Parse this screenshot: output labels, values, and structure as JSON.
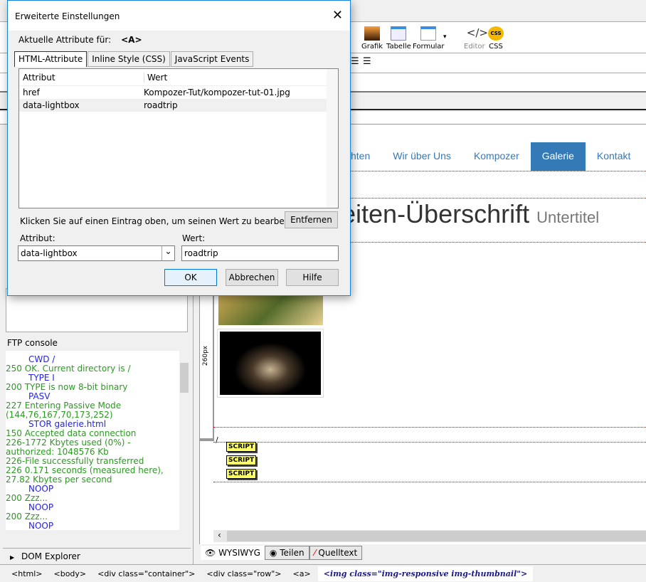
{
  "toolbar": {
    "items": [
      {
        "label": "Grafik",
        "icon": "image-icon"
      },
      {
        "label": "Tabelle",
        "icon": "table-icon"
      },
      {
        "label": "Formular",
        "icon": "form-icon"
      },
      {
        "label": "Editor",
        "icon": "code-editor-icon"
      },
      {
        "label": "CSS",
        "icon": "css-palette-icon"
      }
    ]
  },
  "nav": {
    "items": [
      "chten",
      "Wir über Uns",
      "Kompozer",
      "Galerie",
      "Kontakt"
    ],
    "active": "Galerie"
  },
  "page": {
    "heading": "eiten-Überschrift",
    "subtitle": "Untertitel",
    "ruler_label": "260px",
    "slash": "/",
    "scripts": [
      "SCRIPT",
      "SCRIPT",
      "SCRIPT"
    ]
  },
  "dialog": {
    "title": "Erweiterte Einstellungen",
    "current_label": "Aktuelle Attribute für:",
    "current_tag": "<A>",
    "tabs": [
      "HTML-Attribute",
      "Inline Style (CSS)",
      "JavaScript Events"
    ],
    "columns": [
      "Attribut",
      "Wert"
    ],
    "rows": [
      {
        "attr": "href",
        "value": "Kompozer-Tut/kompozer-tut-01.jpg"
      },
      {
        "attr": "data-lightbox",
        "value": "roadtrip"
      }
    ],
    "hint": "Klicken Sie auf einen Eintrag oben, um seinen Wert zu bearbeiten",
    "remove": "Entfernen",
    "attr_label": "Attribut:",
    "value_label": "Wert:",
    "attr_value": "data-lightbox",
    "value_value": "roadtrip",
    "ok": "OK",
    "cancel": "Abbrechen",
    "help": "Hilfe"
  },
  "ftp": {
    "title": "FTP console",
    "lines": [
      {
        "t": "c",
        "text": "CWD /"
      },
      {
        "t": "r",
        "text": "250 OK. Current directory is /"
      },
      {
        "t": "c",
        "text": "TYPE I"
      },
      {
        "t": "r",
        "text": "200 TYPE is now 8-bit binary"
      },
      {
        "t": "c",
        "text": "PASV"
      },
      {
        "t": "r",
        "text": "227 Entering Passive Mode"
      },
      {
        "t": "r",
        "text": "(144,76,167,70,173,252)"
      },
      {
        "t": "c",
        "text": "STOR galerie.html"
      },
      {
        "t": "r",
        "text": "150 Accepted data connection"
      },
      {
        "t": "r",
        "text": "226-1772 Kbytes used (0%) -"
      },
      {
        "t": "r",
        "text": "authorized: 1048576 Kb"
      },
      {
        "t": "r",
        "text": "226-File successfully transferred"
      },
      {
        "t": "r",
        "text": "226 0.171 seconds (measured here),"
      },
      {
        "t": "r",
        "text": "27.82 Kbytes per second"
      },
      {
        "t": "c",
        "text": "NOOP"
      },
      {
        "t": "r",
        "text": "200 Zzz..."
      },
      {
        "t": "c",
        "text": "NOOP"
      },
      {
        "t": "r",
        "text": "200 Zzz..."
      },
      {
        "t": "c",
        "text": "NOOP"
      }
    ]
  },
  "dom_explorer": "DOM Explorer",
  "view_tabs": [
    "WYSIWYG",
    "Teilen",
    "Quelltext"
  ],
  "status": {
    "crumbs": [
      "<html>",
      "<body>",
      "<div class=\"container\">",
      "<div class=\"row\">",
      "<a>"
    ],
    "current": "<img class=\"img-responsive img-thumbnail\">"
  }
}
